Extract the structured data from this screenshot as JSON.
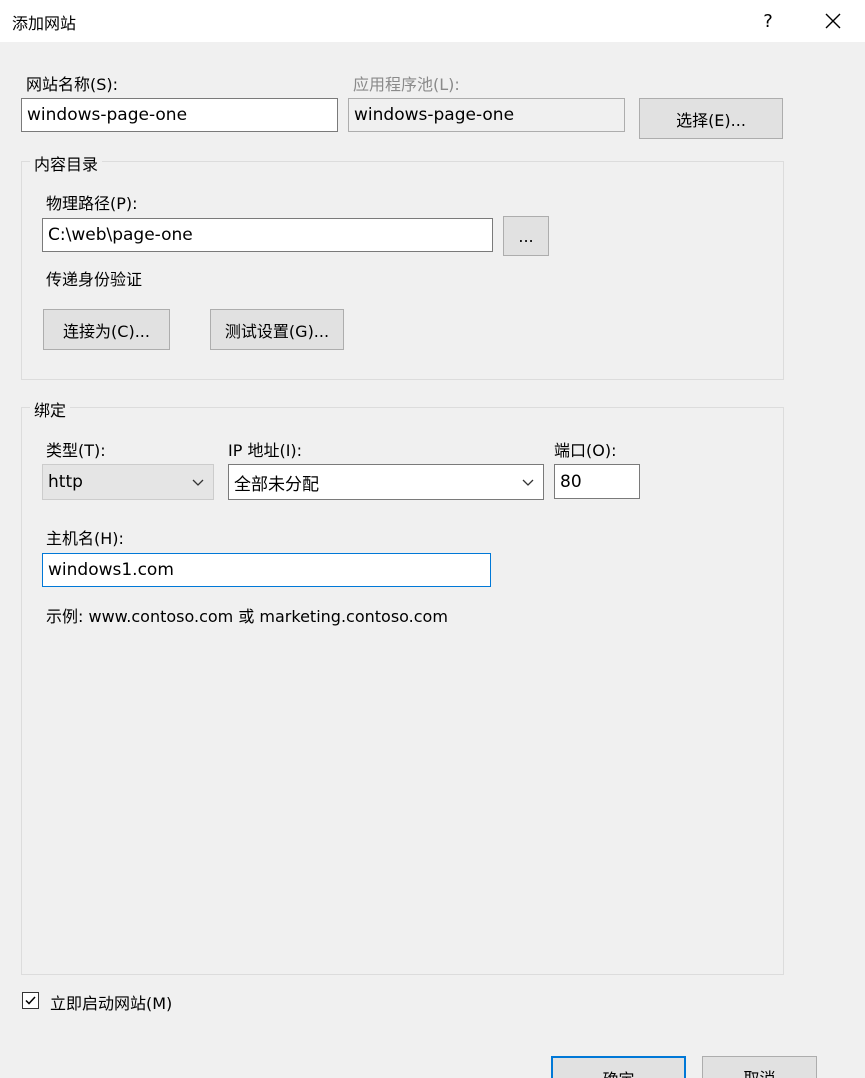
{
  "window": {
    "title": "添加网站",
    "help_label": "?"
  },
  "site": {
    "name_label": "网站名称(S):",
    "name_value": "windows-page-one",
    "pool_label": "应用程序池(L):",
    "pool_value": "windows-page-one",
    "select_button": "选择(E)..."
  },
  "content": {
    "group_label": "内容目录",
    "path_label": "物理路径(P):",
    "path_value": "C:\\web\\page-one",
    "browse_button": "...",
    "auth_label": "传递身份验证",
    "connect_as_button": "连接为(C)...",
    "test_settings_button": "测试设置(G)..."
  },
  "binding": {
    "group_label": "绑定",
    "type_label": "类型(T):",
    "type_value": "http",
    "ip_label": "IP 地址(I):",
    "ip_value": "全部未分配",
    "port_label": "端口(O):",
    "port_value": "80",
    "host_label": "主机名(H):",
    "host_value": "windows1.com",
    "example_text": "示例: www.contoso.com 或 marketing.contoso.com"
  },
  "options": {
    "start_now_label": "立即启动网站(M)",
    "start_now_checked": true
  },
  "footer": {
    "ok_button": "确定",
    "cancel_button": "取消"
  }
}
